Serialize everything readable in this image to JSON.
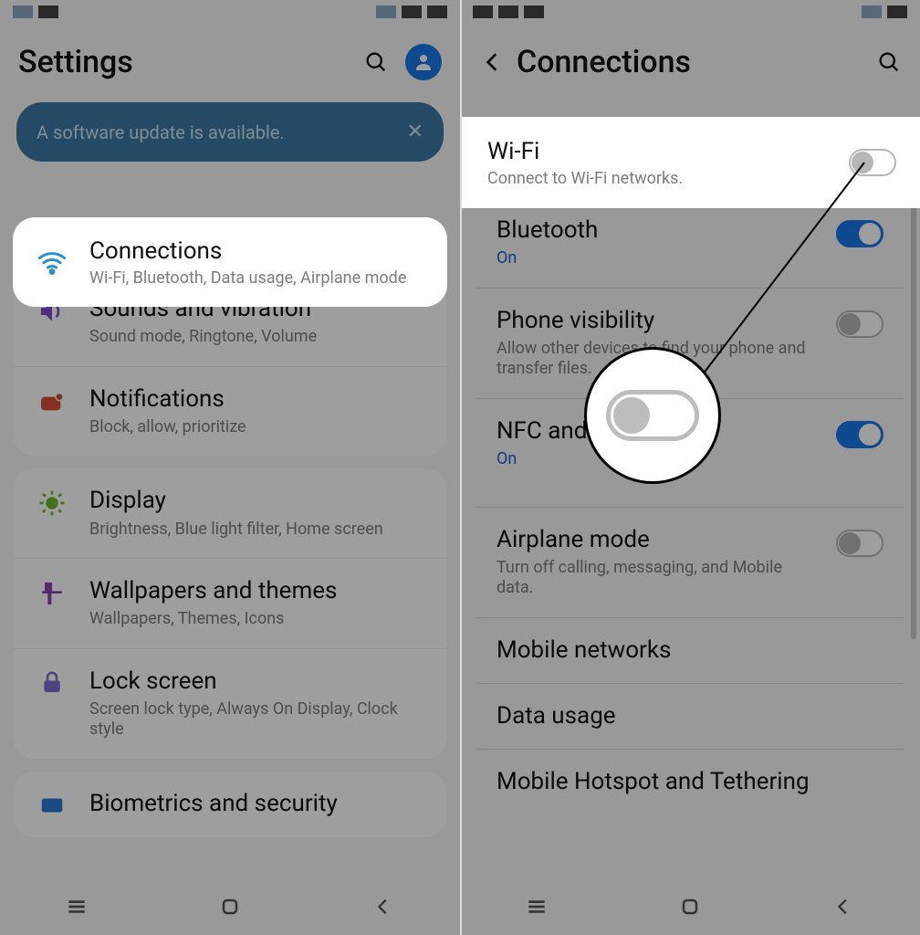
{
  "left": {
    "header_title": "Settings",
    "banner_text": "A software update is available.",
    "connections": {
      "title": "Connections",
      "sub": "Wi-Fi, Bluetooth, Data usage, Airplane mode"
    },
    "sounds": {
      "title": "Sounds and vibration",
      "sub": "Sound mode, Ringtone, Volume"
    },
    "notifications": {
      "title": "Notifications",
      "sub": "Block, allow, prioritize"
    },
    "display": {
      "title": "Display",
      "sub": "Brightness, Blue light filter, Home screen"
    },
    "wallpapers": {
      "title": "Wallpapers and themes",
      "sub": "Wallpapers, Themes, Icons"
    },
    "lockscreen": {
      "title": "Lock screen",
      "sub": "Screen lock type, Always On Display, Clock style"
    },
    "biometrics": {
      "title": "Biometrics and security"
    }
  },
  "right": {
    "header_title": "Connections",
    "wifi": {
      "title": "Wi-Fi",
      "sub": "Connect to Wi-Fi networks."
    },
    "bluetooth": {
      "title": "Bluetooth",
      "status": "On"
    },
    "visibility": {
      "title": "Phone visibility",
      "sub": "Allow other devices to find your phone and transfer files."
    },
    "nfc": {
      "title": "NFC and payment",
      "status": "On"
    },
    "airplane": {
      "title": "Airplane mode",
      "sub": "Turn off calling, messaging, and Mobile data."
    },
    "mobile_networks": {
      "title": "Mobile networks"
    },
    "data_usage": {
      "title": "Data usage"
    },
    "hotspot": {
      "title": "Mobile Hotspot and Tethering"
    }
  }
}
